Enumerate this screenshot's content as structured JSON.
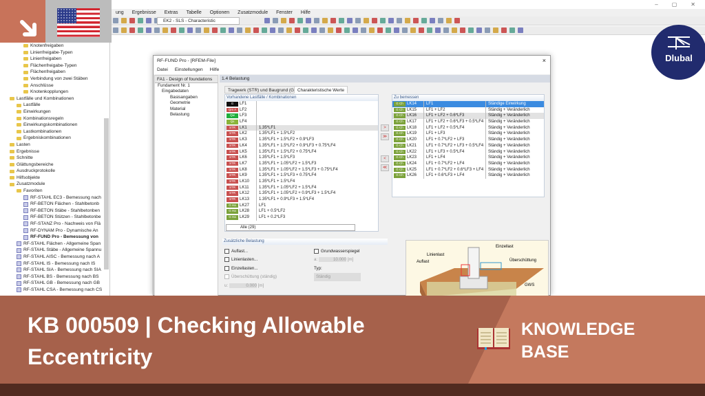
{
  "menu": [
    "ung",
    "Ergebnisse",
    "Extras",
    "Tabelle",
    "Optionen",
    "Zusatzmodule",
    "Fenster",
    "Hilfe"
  ],
  "toolbar": {
    "load_case": "EK2 - SLS - Characteristic"
  },
  "tree": [
    {
      "l": "Knotenfreigaben",
      "d": 3,
      "t": "f"
    },
    {
      "l": "Linienfreigabe-Typen",
      "d": 3,
      "t": "f"
    },
    {
      "l": "Linienfreigaben",
      "d": 3,
      "t": "f"
    },
    {
      "l": "Flächenfreigabe-Typen",
      "d": 3,
      "t": "f"
    },
    {
      "l": "Flächenfreigaben",
      "d": 3,
      "t": "f"
    },
    {
      "l": "Verbindung von zwei Stäben",
      "d": 3,
      "t": "f"
    },
    {
      "l": "Anschlüsse",
      "d": 3,
      "t": "f"
    },
    {
      "l": "Knotenkopplungen",
      "d": 3,
      "t": "f"
    },
    {
      "l": "Lastfälle und Kombinationen",
      "d": 1,
      "t": "f"
    },
    {
      "l": "Lastfälle",
      "d": 2,
      "t": "f"
    },
    {
      "l": "Einwirkungen",
      "d": 2,
      "t": "f"
    },
    {
      "l": "Kombinationsregeln",
      "d": 2,
      "t": "f"
    },
    {
      "l": "Einwirkungskombinationen",
      "d": 2,
      "t": "f"
    },
    {
      "l": "Lastkombinationen",
      "d": 2,
      "t": "f"
    },
    {
      "l": "Ergebniskombinationen",
      "d": 2,
      "t": "f"
    },
    {
      "l": "Lasten",
      "d": 1,
      "t": "f"
    },
    {
      "l": "Ergebnisse",
      "d": 1,
      "t": "f"
    },
    {
      "l": "Schnitte",
      "d": 1,
      "t": "f"
    },
    {
      "l": "Glättungsbereiche",
      "d": 1,
      "t": "f"
    },
    {
      "l": "Ausdruckprotokolle",
      "d": 1,
      "t": "f"
    },
    {
      "l": "Hilfsobjekte",
      "d": 1,
      "t": "f"
    },
    {
      "l": "Zusatzmodule",
      "d": 1,
      "t": "f"
    },
    {
      "l": "Favoriten",
      "d": 2,
      "t": "f"
    },
    {
      "l": "RF-STAHL EC3 - Bemessung nach",
      "d": 3,
      "t": "m"
    },
    {
      "l": "RF-BETON Flächen - Stahlbetonb",
      "d": 3,
      "t": "m"
    },
    {
      "l": "RF-BETON Stäbe - Stahlbetonben",
      "d": 3,
      "t": "m"
    },
    {
      "l": "RF-BETON Stützen - Stahlbetonbe",
      "d": 3,
      "t": "m"
    },
    {
      "l": "RF-STANZ Pro - Nachweis von Flä",
      "d": 3,
      "t": "m"
    },
    {
      "l": "RF-DYNAM Pro - Dynamische An",
      "d": 3,
      "t": "m"
    },
    {
      "l": "RF-FUND Pro - Bemessung von",
      "d": 3,
      "t": "m",
      "b": true
    },
    {
      "l": "RF-STAHL Flächen - Allgemeine Span",
      "d": 2,
      "t": "m"
    },
    {
      "l": "RF-STAHL Stäbe - Allgemeine Spannu",
      "d": 2,
      "t": "m"
    },
    {
      "l": "RF-STAHL AISC - Bemessung nach A",
      "d": 2,
      "t": "m"
    },
    {
      "l": "RF-STAHL IS - Bemessung nach IS",
      "d": 2,
      "t": "m"
    },
    {
      "l": "RF-STAHL SIA - Bemessung nach SIA",
      "d": 2,
      "t": "m"
    },
    {
      "l": "RF-STAHL BS - Bemessung nach BS",
      "d": 2,
      "t": "m"
    },
    {
      "l": "RF-STAHL GB - Bemessung nach GB",
      "d": 2,
      "t": "m"
    },
    {
      "l": "RF-STAHL CSA - Bemessung nach CS",
      "d": 2,
      "t": "m"
    }
  ],
  "dialog": {
    "title": "RF-FUND Pro - [RFEM-File]",
    "close": "×",
    "menu": [
      "Datei",
      "Einstellungen",
      "Hilfe"
    ],
    "case_select": "FA1 - Design of foundations",
    "nav": [
      "Fundament Nr. 1",
      "Eingabedaten",
      "Basisangaben",
      "Geometrie",
      "Material",
      "Belastung"
    ],
    "section": "1.4 Belastung",
    "tabs": [
      "Tragwerk (STR) und Baugrund (GEO)",
      "Charakteristische Werte"
    ],
    "left_title": "Vorhandene Lastfälle / Kombinationen",
    "left_rows": [
      {
        "b": "G",
        "c": "#111111",
        "n": "LF1",
        "f": ""
      },
      {
        "b": "Qm A",
        "c": "#c8504f",
        "n": "LF2",
        "f": ""
      },
      {
        "b": "Qw",
        "c": "#1fae3c",
        "n": "LF3",
        "f": ""
      },
      {
        "b": "Qs",
        "c": "#8ab43a",
        "n": "LF4",
        "f": ""
      },
      {
        "b": "STR",
        "c": "#c8504f",
        "n": "LK1",
        "f": "1.35*LF1"
      },
      {
        "b": "STR",
        "c": "#c8504f",
        "n": "LK2",
        "f": "1.35*LF1 + 1.5*LF2"
      },
      {
        "b": "STR",
        "c": "#c8504f",
        "n": "LK3",
        "f": "1.35*LF1 + 1.5*LF2 + 0.9*LF3"
      },
      {
        "b": "STR",
        "c": "#c8504f",
        "n": "LK4",
        "f": "1.35*LF1 + 1.5*LF2 + 0.9*LF3 + 0.75*LF4"
      },
      {
        "b": "STR",
        "c": "#c8504f",
        "n": "LK5",
        "f": "1.35*LF1 + 1.5*LF2 + 0.75*LF4"
      },
      {
        "b": "STR",
        "c": "#c8504f",
        "n": "LK6",
        "f": "1.35*LF1 + 1.5*LF3"
      },
      {
        "b": "STR",
        "c": "#c8504f",
        "n": "LK7",
        "f": "1.35*LF1 + 1.05*LF2 + 1.5*LF3"
      },
      {
        "b": "STR",
        "c": "#c8504f",
        "n": "LK8",
        "f": "1.35*LF1 + 1.05*LF2 + 1.5*LF3 + 0.75*LF4"
      },
      {
        "b": "STR",
        "c": "#c8504f",
        "n": "LK9",
        "f": "1.35*LF1 + 1.5*LF3 + 0.75*LF4"
      },
      {
        "b": "STR",
        "c": "#c8504f",
        "n": "LK10",
        "f": "1.35*LF1 + 1.5*LF4"
      },
      {
        "b": "STR",
        "c": "#c8504f",
        "n": "LK11",
        "f": "1.35*LF1 + 1.05*LF2 + 1.5*LF4"
      },
      {
        "b": "STR",
        "c": "#c8504f",
        "n": "LK12",
        "f": "1.35*LF1 + 1.05*LF2 + 0.9*LF3 + 1.5*LF4"
      },
      {
        "b": "STR",
        "c": "#c8504f",
        "n": "LK13",
        "f": "1.35*LF1 + 0.9*LF3 + 1.5*LF4"
      },
      {
        "b": "G Ha",
        "c": "#7ba23a",
        "n": "LK27",
        "f": "LF1"
      },
      {
        "b": "G Ha",
        "c": "#7ba23a",
        "n": "LK28",
        "f": "LF1 + 0.5*LF2"
      },
      {
        "b": "G Ha",
        "c": "#7ba23a",
        "n": "LK29",
        "f": "LF1 + 0.2*LF3"
      }
    ],
    "filter": "Alle (29)",
    "right_title": "Zu bemessen",
    "right_rows": [
      {
        "n": "LK14",
        "f": "LF1",
        "t": "Ständige Einwirkung"
      },
      {
        "n": "LK15",
        "f": "LF1 + LF2",
        "t": "Ständig + Veränderlich"
      },
      {
        "n": "LK16",
        "f": "LF1 + LF2 + 0.6*LF3",
        "t": "Ständig + Veränderlich"
      },
      {
        "n": "LK17",
        "f": "LF1 + LF2 + 0.6*LF3 + 0.5*LF4",
        "t": "Ständig + Veränderlich"
      },
      {
        "n": "LK18",
        "f": "LF1 + LF2 + 0.5*LF4",
        "t": "Ständig + Veränderlich"
      },
      {
        "n": "LK19",
        "f": "LF1 + LF3",
        "t": "Ständig + Veränderlich"
      },
      {
        "n": "LK20",
        "f": "LF1 + 0.7*LF2 + LF3",
        "t": "Ständig + Veränderlich"
      },
      {
        "n": "LK21",
        "f": "LF1 + 0.7*LF2 + LF3 + 0.5*LF4",
        "t": "Ständig + Veränderlich"
      },
      {
        "n": "LK22",
        "f": "LF1 + LF3 + 0.5*LF4",
        "t": "Ständig + Veränderlich"
      },
      {
        "n": "LK23",
        "f": "LF1 + LF4",
        "t": "Ständig + Veränderlich"
      },
      {
        "n": "LK24",
        "f": "LF1 + 0.7*LF2 + LF4",
        "t": "Ständig + Veränderlich"
      },
      {
        "n": "LK25",
        "f": "LF1 + 0.7*LF2 + 0.6*LF3 + LF4",
        "t": "Ständig + Veränderlich"
      },
      {
        "n": "LK26",
        "f": "LF1 + 0.6*LF3 + LF4",
        "t": "Ständig + Veränderlich"
      }
    ],
    "right_badge": "G Ch",
    "extra": {
      "title": "Zusätzliche Belastung",
      "auflast": "Auflast...",
      "linienlasten": "Linienlasten...",
      "einzellasten": "Einzellasten...",
      "ueberschuettung": "Überschüttung (ständig)",
      "u_label": "u:",
      "u_value": "0.000",
      "grund": "Grundwasserspiegel",
      "a_label": "a:",
      "a_value": "10.000",
      "unit": "[m]",
      "typ_label": "Typ:",
      "typ_value": "Ständig"
    },
    "figure": {
      "einzellast": "Einzellast",
      "linienlast": "Linienlast",
      "auflast": "Auflast",
      "ueberschuettung": "Überschüttung",
      "gws": "GWS"
    }
  },
  "brand": {
    "name": "Dlubal",
    "color": "#212b6e"
  },
  "banner": {
    "title": "KB 000509 | Checking Allowable Eccentricity",
    "kb_line1": "KNOWLEDGE",
    "kb_line2": "BASE"
  }
}
